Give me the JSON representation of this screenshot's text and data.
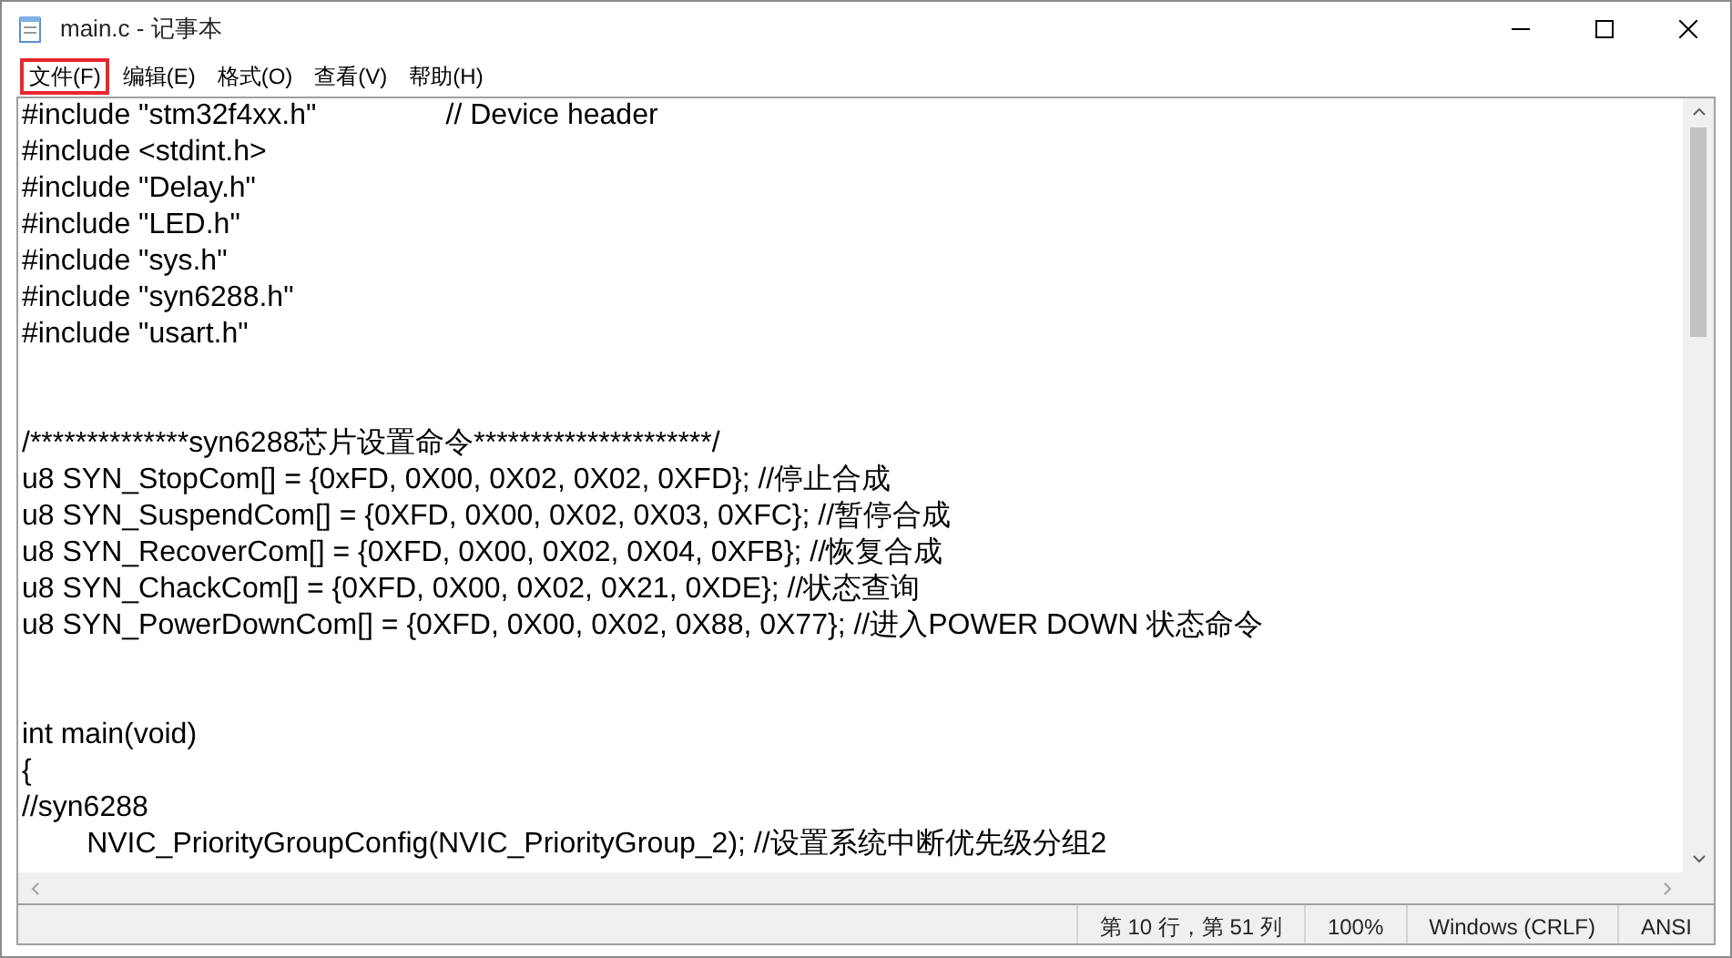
{
  "window": {
    "title": "main.c - 记事本"
  },
  "menu": [
    {
      "label": "文件(F)",
      "highlighted": true
    },
    {
      "label": "编辑(E)",
      "highlighted": false
    },
    {
      "label": "格式(O)",
      "highlighted": false
    },
    {
      "label": "查看(V)",
      "highlighted": false
    },
    {
      "label": "帮助(H)",
      "highlighted": false
    }
  ],
  "editor": {
    "lines": [
      {
        "kind": "code",
        "text": "#include \"stm32f4xx.h\"                // Device header"
      },
      {
        "kind": "code",
        "text": "#include <stdint.h>"
      },
      {
        "kind": "code",
        "text": "#include \"Delay.h\""
      },
      {
        "kind": "code",
        "text": "#include \"LED.h\""
      },
      {
        "kind": "code",
        "text": "#include \"sys.h\""
      },
      {
        "kind": "code",
        "text": "#include \"syn6288.h\""
      },
      {
        "kind": "code",
        "text": "#include \"usart.h\""
      },
      {
        "kind": "blank"
      },
      {
        "kind": "blank"
      },
      {
        "kind": "code",
        "text": "/**************syn6288芯片设置命令*********************/"
      },
      {
        "kind": "code",
        "text": "u8 SYN_StopCom[] = {0xFD, 0X00, 0X02, 0X02, 0XFD}; //停止合成"
      },
      {
        "kind": "code",
        "text": "u8 SYN_SuspendCom[] = {0XFD, 0X00, 0X02, 0X03, 0XFC}; //暂停合成"
      },
      {
        "kind": "code",
        "text": "u8 SYN_RecoverCom[] = {0XFD, 0X00, 0X02, 0X04, 0XFB}; //恢复合成"
      },
      {
        "kind": "code",
        "text": "u8 SYN_ChackCom[] = {0XFD, 0X00, 0X02, 0X21, 0XDE}; //状态查询"
      },
      {
        "kind": "code",
        "text": "u8 SYN_PowerDownCom[] = {0XFD, 0X00, 0X02, 0X88, 0X77}; //进入POWER DOWN 状态命令"
      },
      {
        "kind": "blank"
      },
      {
        "kind": "blank"
      },
      {
        "kind": "code",
        "text": "int main(void)"
      },
      {
        "kind": "code",
        "text": "{"
      },
      {
        "kind": "code",
        "text": "//syn6288"
      },
      {
        "kind": "code",
        "text": "        NVIC_PriorityGroupConfig(NVIC_PriorityGroup_2); //设置系统中断优先级分组2"
      }
    ]
  },
  "status_bar": {
    "position": "第 10 行，第 51 列",
    "zoom": "100%",
    "line_ending": "Windows (CRLF)",
    "encoding": "ANSI"
  }
}
